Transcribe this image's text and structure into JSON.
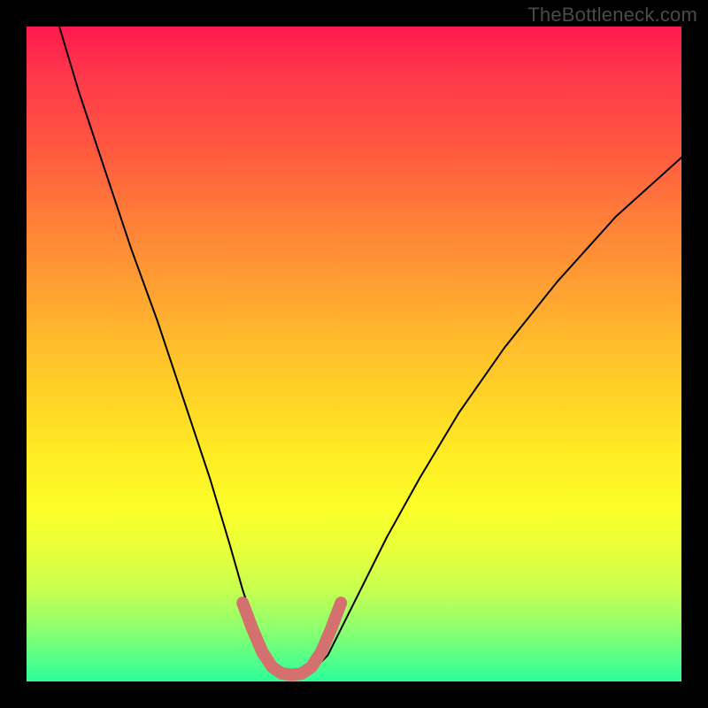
{
  "watermark": "TheBottleneck.com",
  "chart_data": {
    "type": "line",
    "title": "",
    "xlabel": "",
    "ylabel": "",
    "xlim": [
      0,
      100
    ],
    "ylim": [
      0,
      100
    ],
    "grid": false,
    "series": [
      {
        "name": "bottleneck-curve",
        "color": "#000000",
        "stroke_width": 2,
        "x": [
          5,
          8,
          12,
          16,
          20,
          24,
          28,
          31,
          33,
          35,
          36.5,
          38,
          40,
          42,
          44,
          46,
          48,
          51,
          55,
          60,
          66,
          73,
          81,
          90,
          100
        ],
        "y": [
          100,
          90,
          78,
          66,
          55,
          43,
          31,
          21,
          14,
          8,
          4,
          2,
          1,
          1,
          2,
          4,
          8,
          14,
          22,
          31,
          41,
          51,
          61,
          71,
          80
        ]
      },
      {
        "name": "highlight-basin",
        "color": "#d4706e",
        "stroke_width": 14,
        "x": [
          33,
          34.5,
          36,
          37.5,
          39,
          40.5,
          42,
          43.5,
          45,
          46.5,
          48
        ],
        "y": [
          12,
          8,
          4.5,
          2.2,
          1.2,
          1,
          1.2,
          2.2,
          4.5,
          8,
          12
        ]
      }
    ],
    "background_gradient": {
      "top": "#ff1a4d",
      "mid": "#ffed24",
      "bottom": "#2bff9a"
    }
  }
}
